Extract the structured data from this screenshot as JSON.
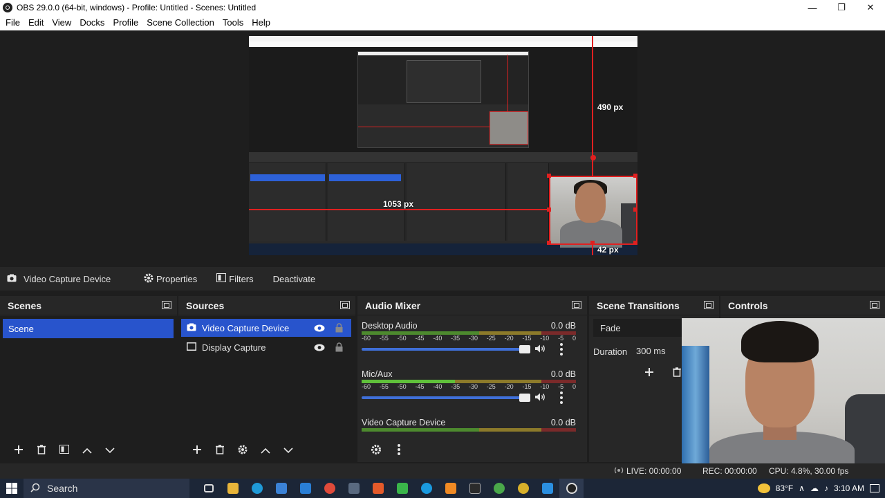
{
  "window": {
    "title": "OBS 29.0.0 (64-bit, windows) - Profile: Untitled - Scenes: Untitled"
  },
  "menu": [
    "File",
    "Edit",
    "View",
    "Docks",
    "Profile",
    "Scene Collection",
    "Tools",
    "Help"
  ],
  "preview": {
    "measure_vertical": "490 px",
    "measure_horizontal": "1053 px",
    "measure_bottom": "42 px"
  },
  "context_bar": {
    "source_name": "Video Capture Device",
    "properties_label": "Properties",
    "filters_label": "Filters",
    "deactivate_label": "Deactivate"
  },
  "scenes": {
    "title": "Scenes",
    "items": [
      {
        "label": "Scene",
        "selected": true
      }
    ]
  },
  "sources": {
    "title": "Sources",
    "items": [
      {
        "label": "Video Capture Device",
        "icon": "camera-icon",
        "selected": true
      },
      {
        "label": "Display Capture",
        "icon": "monitor-icon",
        "selected": false
      }
    ]
  },
  "audio_mixer": {
    "title": "Audio Mixer",
    "channels": [
      {
        "name": "Desktop Audio",
        "db": "0.0 dB"
      },
      {
        "name": "Mic/Aux",
        "db": "0.0 dB"
      },
      {
        "name": "Video Capture Device",
        "db": "0.0 dB"
      }
    ],
    "ticks": [
      "-60",
      "-55",
      "-50",
      "-45",
      "-40",
      "-35",
      "-30",
      "-25",
      "-20",
      "-15",
      "-10",
      "-5",
      "0"
    ]
  },
  "scene_transitions": {
    "title": "Scene Transitions",
    "transition": "Fade",
    "duration_label": "Duration",
    "duration_value": "300 ms"
  },
  "controls": {
    "title": "Controls"
  },
  "status": {
    "live": "LIVE: 00:00:00",
    "rec": "REC: 00:00:00",
    "cpu": "CPU: 4.8%, 30.00 fps"
  },
  "taskbar": {
    "search_placeholder": "Search",
    "temperature": "83°F",
    "time": "3:10 AM"
  },
  "colors": {
    "accent": "#2854cc",
    "bounding_box": "#e02020",
    "panel_bg": "#272727",
    "list_bg": "#1e1e1e"
  }
}
